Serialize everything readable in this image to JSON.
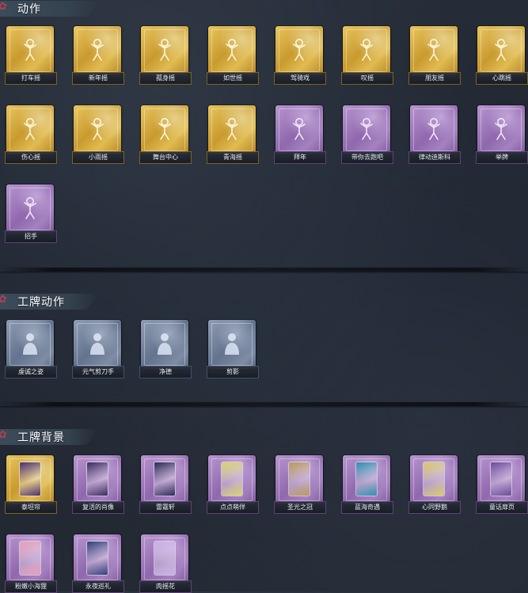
{
  "sections": [
    {
      "title": "动作",
      "items": [
        {
          "label": "打车摇",
          "style": "gold",
          "icon": "pose-figure-icon"
        },
        {
          "label": "新年摇",
          "style": "gold",
          "icon": "pose-figure-icon"
        },
        {
          "label": "孤身摇",
          "style": "gold",
          "icon": "pose-figure-icon"
        },
        {
          "label": "如世摇",
          "style": "gold",
          "icon": "pose-figure-icon"
        },
        {
          "label": "驾骑戏",
          "style": "gold",
          "icon": "pose-figure-icon"
        },
        {
          "label": "叹摇",
          "style": "gold",
          "icon": "pose-figure-icon"
        },
        {
          "label": "朋友摇",
          "style": "gold",
          "icon": "pose-figure-icon"
        },
        {
          "label": "心跳摇",
          "style": "gold",
          "icon": "pose-figure-icon"
        },
        {
          "label": "伤心摇",
          "style": "gold",
          "icon": "pose-figure-icon"
        },
        {
          "label": "小雨摇",
          "style": "gold",
          "icon": "pose-figure-icon"
        },
        {
          "label": "舞台中心",
          "style": "gold",
          "icon": "pose-figure-icon"
        },
        {
          "label": "青海摇",
          "style": "gold",
          "icon": "pose-figure-icon"
        },
        {
          "label": "拜年",
          "style": "purple",
          "icon": "pose-figure-icon"
        },
        {
          "label": "带你去跑吧",
          "style": "purple",
          "icon": "pose-figure-icon"
        },
        {
          "label": "律动迪斯科",
          "style": "purple",
          "icon": "pose-figure-icon"
        },
        {
          "label": "举牌",
          "style": "purple",
          "icon": "pose-figure-icon"
        },
        {
          "label": "招手",
          "style": "purple",
          "icon": "pose-figure-icon"
        }
      ]
    },
    {
      "title": "工牌动作",
      "items": [
        {
          "label": "虔诚之姿",
          "style": "blue",
          "icon": "silhouette-icon"
        },
        {
          "label": "元气剪刀手",
          "style": "blue",
          "icon": "silhouette-icon"
        },
        {
          "label": "净德",
          "style": "blue",
          "icon": "silhouette-icon"
        },
        {
          "label": "剪影",
          "style": "blue",
          "icon": "silhouette-icon"
        }
      ]
    },
    {
      "title": "工牌背景",
      "items": [
        {
          "label": "泰坦帘",
          "style": "gold",
          "pic": "#4a2f6e"
        },
        {
          "label": "复活的肖像",
          "style": "purple",
          "pic": "#3b2a5e"
        },
        {
          "label": "雷霆轩",
          "style": "purple",
          "pic": "#2c2a55"
        },
        {
          "label": "点点萌佯",
          "style": "purple",
          "pic": "#d8d36b"
        },
        {
          "label": "圣光之冠",
          "style": "purple",
          "pic": "#b99a5e"
        },
        {
          "label": "蓝海奇遇",
          "style": "purple",
          "pic": "#2f8fae"
        },
        {
          "label": "心同野鹅",
          "style": "purple",
          "pic": "#d8c96a"
        },
        {
          "label": "童话扉页",
          "style": "purple",
          "pic": "#6b4a9a"
        },
        {
          "label": "粉嫩小海狸",
          "style": "purple",
          "pic": "#e79fb9"
        },
        {
          "label": "永夜巡礼",
          "style": "purple",
          "pic": "#2f3f7a"
        },
        {
          "label": "肉摇花",
          "style": "purple",
          "pic": "#c7b2e6"
        }
      ]
    }
  ]
}
